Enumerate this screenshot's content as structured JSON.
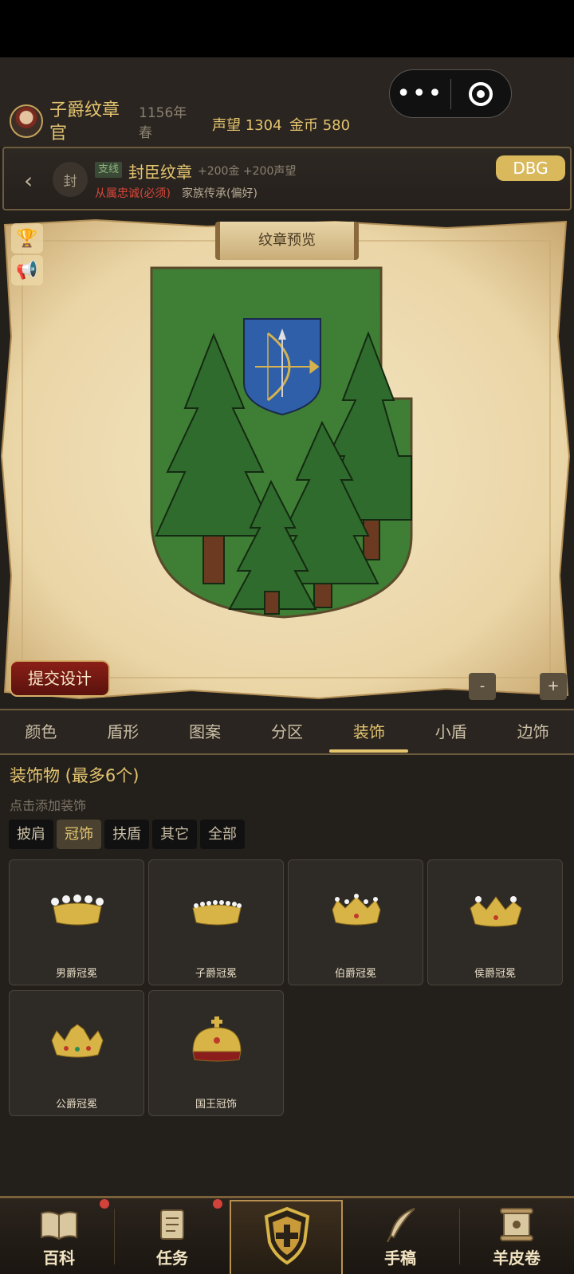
{
  "header": {
    "title": "子爵纹章官",
    "date": "1156年春",
    "reputation_label": "声望 1304",
    "gold_label": "金币 580"
  },
  "capsule": {
    "more_icon": "more-dots-icon",
    "close_icon": "target-icon"
  },
  "quest": {
    "badge": "封",
    "tag": "支线",
    "name": "封臣纹章",
    "reward": "+200金 +200声望",
    "requirement": "从属忠诚(必须)",
    "preference": "家族传承(偏好)",
    "debug_label": "DBG"
  },
  "preview": {
    "title": "纹章预览",
    "submit_label": "提交设计",
    "zoom_out": "-",
    "zoom_in": "+"
  },
  "tabs": [
    "颜色",
    "盾形",
    "图案",
    "分区",
    "装饰",
    "小盾",
    "边饰"
  ],
  "active_tab": "装饰",
  "decorations": {
    "title": "装饰物 (最多6个)",
    "hint": "点击添加装饰",
    "filters": [
      "披肩",
      "冠饰",
      "扶盾",
      "其它",
      "全部"
    ],
    "active_filter": "冠饰",
    "items": [
      {
        "label": "男爵冠冕"
      },
      {
        "label": "子爵冠冕"
      },
      {
        "label": "伯爵冠冕"
      },
      {
        "label": "侯爵冠冕"
      },
      {
        "label": "公爵冠冕"
      },
      {
        "label": "国王冠饰"
      }
    ]
  },
  "nav": [
    {
      "label": "百科"
    },
    {
      "label": "任务"
    },
    {
      "label": ""
    },
    {
      "label": "手稿"
    },
    {
      "label": "羊皮卷"
    }
  ],
  "colors": {
    "accent": "#e4c46f",
    "field_green": "#3f7f35",
    "inescutcheon_blue": "#2f5fa8",
    "alert_red": "#d9473a"
  }
}
